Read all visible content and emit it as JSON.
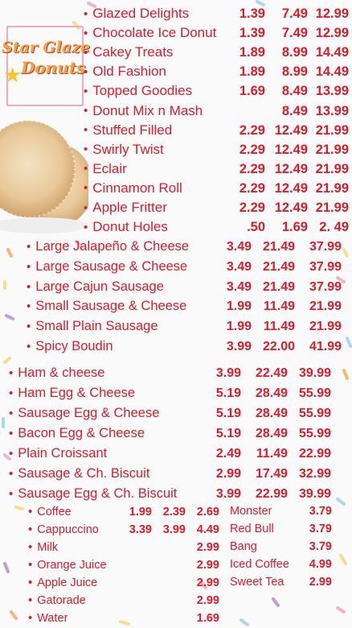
{
  "brand": {
    "line1": "Star Glaze",
    "line2": "Donuts"
  },
  "donuts": [
    {
      "name": "Glazed Delights",
      "p1": "1.39",
      "p2": "7.49",
      "p3": "12.99"
    },
    {
      "name": "Chocolate Ice Donut",
      "p1": "1.39",
      "p2": "7.49",
      "p3": "12.99"
    },
    {
      "name": "Cakey  Treats",
      "p1": "1.89",
      "p2": "8.99",
      "p3": "14.49"
    },
    {
      "name": "Old Fashion",
      "p1": "1.89",
      "p2": "8.99",
      "p3": "14.49"
    },
    {
      "name": "Topped Goodies",
      "p1": "1.69",
      "p2": "8.49",
      "p3": "13.99"
    },
    {
      "name": "Donut Mix n Mash",
      "p1": "",
      "p2": "8.49",
      "p3": "13.99"
    },
    {
      "name": " Stuffed Filled",
      "p1": "2.29",
      "p2": "12.49",
      "p3": "21.99"
    },
    {
      "name": "Swirly Twist",
      "p1": "2.29",
      "p2": "12.49",
      "p3": "21.99"
    },
    {
      "name": " Eclair",
      "p1": "2.29",
      "p2": "12.49",
      "p3": "21.99"
    },
    {
      "name": "Cinnamon Roll",
      "p1": "2.29",
      "p2": "12.49",
      "p3": "21.99"
    },
    {
      "name": "Apple Fritter",
      "p1": "2.29",
      "p2": "12.49",
      "p3": "21.99"
    },
    {
      "name": "Donut Holes",
      "p1": ".50",
      "p2": "1.69",
      "p3": "2. 49"
    }
  ],
  "kolaches": [
    {
      "name": "Large Jalapeño & Cheese",
      "p1": "3.49",
      "p2": "21.49",
      "p3": "37.99"
    },
    {
      "name": "Large Sausage & Cheese",
      "p1": "3.49",
      "p2": "21.49",
      "p3": "37.99"
    },
    {
      "name": "Large Cajun Sausage",
      "p1": "3.49",
      "p2": "21.49",
      "p3": "37.99"
    },
    {
      "name": "Small Sausage & Cheese",
      "p1": "1.99",
      "p2": "11.49",
      "p3": "21.99"
    },
    {
      "name": "Small Plain Sausage",
      "p1": "1.99",
      "p2": "11.49",
      "p3": "21.99"
    },
    {
      "name": "Spicy Boudin",
      "p1": "3.99",
      "p2": "22.00",
      "p3": "41.99"
    }
  ],
  "breakfast": [
    {
      "name": "Ham & cheese",
      "p1": "3.99",
      "p2": "22.49",
      "p3": "39.99"
    },
    {
      "name": "Ham Egg & Cheese",
      "p1": "5.19",
      "p2": "28.49",
      "p3": "55.99"
    },
    {
      "name": "Sausage Egg & Cheese",
      "p1": "5.19",
      "p2": "28.49",
      "p3": "55.99"
    },
    {
      "name": "Bacon Egg & Cheese",
      "p1": "5.19",
      "p2": "28.49",
      "p3": "55.99"
    },
    {
      "name": "Plain Croissant",
      "p1": "2.49",
      "p2": "11.49",
      "p3": "22.99"
    },
    {
      "name": "Sausage & Ch. Biscuit",
      "p1": "2.99",
      "p2": "17.49",
      "p3": "32.99"
    },
    {
      "name": "Sausage Egg & Ch. Biscuit",
      "p1": "3.99",
      "p2": "22.99",
      "p3": "39.99"
    }
  ],
  "beverages_left": [
    {
      "name": "Coffee",
      "p1": "1.99",
      "p2": "2.39",
      "p3": "2.69"
    },
    {
      "name": "Cappuccino",
      "p1": "3.39",
      "p2": "3.99",
      "p3": "4.49"
    },
    {
      "name": "Milk",
      "p1": "",
      "p2": "",
      "p3": "2.99"
    },
    {
      "name": "Orange Juice",
      "p1": "",
      "p2": "",
      "p3": "2.99"
    },
    {
      "name": "Apple Juice",
      "p1": "",
      "p2": "",
      "p3": "2.99"
    },
    {
      "name": "Gatorade",
      "p1": "",
      "p2": "",
      "p3": "2.99"
    },
    {
      "name": "Water",
      "p1": "",
      "p2": "",
      "p3": "1.69"
    }
  ],
  "beverages_right": [
    {
      "name": "Monster",
      "price": "3.79"
    },
    {
      "name": "Red Bull",
      "price": "3.79"
    },
    {
      "name": "Bang",
      "price": "3.79"
    },
    {
      "name": "Iced Coffee",
      "price": "4.99"
    },
    {
      "name": "Sweet Tea",
      "price": "2.99"
    }
  ],
  "colors": {
    "text": "#dc1c2a",
    "logo": "#f3a24a",
    "frame": "#f2a9c8"
  }
}
